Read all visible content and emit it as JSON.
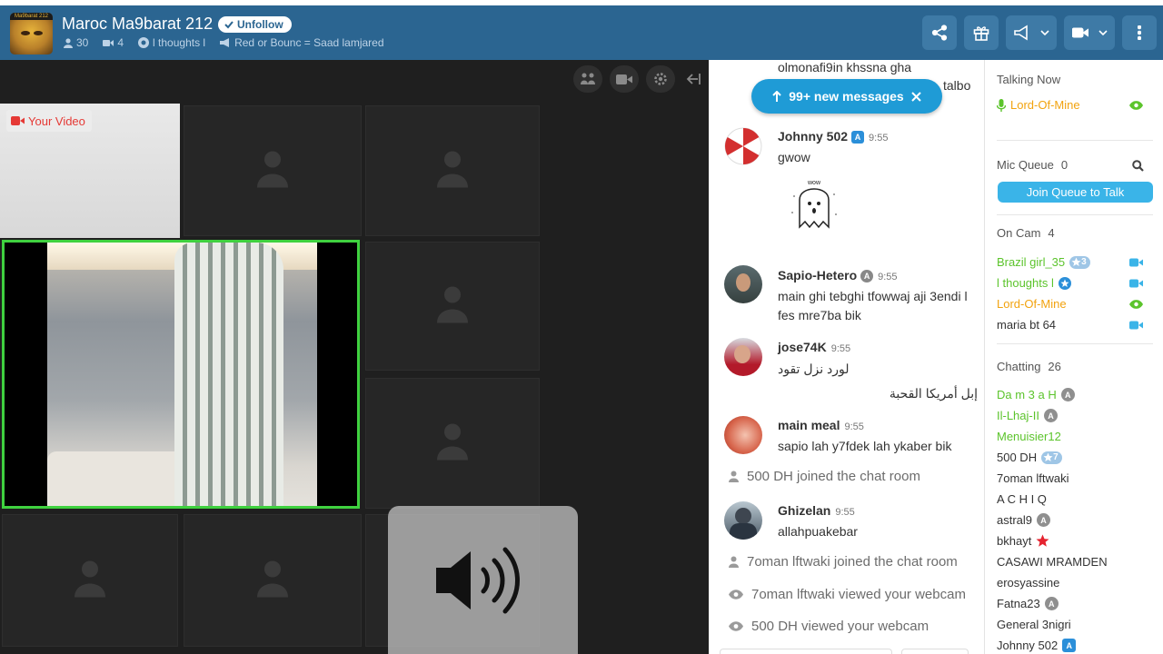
{
  "header": {
    "room_title": "Maroc Ma9barat 212",
    "room_avatar_caption": "Ma9barat 212",
    "unfollow_label": "Unfollow",
    "users_count": "30",
    "cams_count": "4",
    "owner": "l thoughts l",
    "topic": "Red or Bounc = Saad lamjared",
    "buttons": [
      "share-icon",
      "gift-icon",
      "broadcast-icon",
      "camera-icon",
      "more-icon"
    ]
  },
  "video": {
    "your_video_label": "Your Video",
    "tools": [
      "hide-users-icon",
      "camera-toggle-icon",
      "settings-icon",
      "collapse-icon"
    ],
    "volume_overlay_icon": "speaker-volume-icon"
  },
  "chat": {
    "top_partial_1": "olmonafi9in khssna gha",
    "top_partial_2": "talbo",
    "new_messages_label": "99+ new messages",
    "messages": [
      {
        "name": "Johnny 502",
        "badge": "A",
        "time": "9:55",
        "text": "gwow"
      },
      {
        "name": "Sapio-Hetero",
        "badge": "A",
        "time": "9:55",
        "text": "main ghi tebghi tfowwaj aji 3endi l fes mre7ba bik"
      },
      {
        "name": "jose74K",
        "badge": "",
        "time": "9:55",
        "text1": "لورد نزل تقود",
        "text2": "إبل أمريكا القحبة"
      },
      {
        "name": "main meal",
        "badge": "",
        "time": "9:55",
        "text": "sapio lah y7fdek lah ykaber bik"
      },
      {
        "name": "Ghizelan",
        "badge": "",
        "time": "9:55",
        "text": "allahpuakebar"
      }
    ],
    "system": [
      "500 DH joined the chat room",
      "7oman lftwaki joined the chat room",
      "7oman lftwaki viewed your webcam",
      "500 DH viewed your webcam"
    ],
    "sticker_text": "wow"
  },
  "sidebar": {
    "talking_now_label": "Talking Now",
    "talking_user": "Lord-Of-Mine",
    "mic_queue_label": "Mic Queue",
    "mic_queue_count": "0",
    "join_queue_label": "Join Queue to Talk",
    "on_cam_label": "On Cam",
    "on_cam_count": "4",
    "on_cam_users": [
      {
        "name": "Brazil girl_35",
        "level": "3"
      },
      {
        "name": "l thoughts l"
      },
      {
        "name": "Lord-Of-Mine"
      },
      {
        "name": "maria bt 64"
      }
    ],
    "chatting_label": "Chatting",
    "chatting_count": "26",
    "chatting_users": [
      {
        "name": "Da m 3 a H",
        "badge": "A"
      },
      {
        "name": "Il-Lhaj-II",
        "badge": "A"
      },
      {
        "name": "Menuisier12"
      },
      {
        "name": "500 DH",
        "level": "7"
      },
      {
        "name": "7oman lftwaki"
      },
      {
        "name": "A C H I Q"
      },
      {
        "name": "astral9",
        "badge": "A"
      },
      {
        "name": "bkhayt"
      },
      {
        "name": "CASAWI MRAMDEN"
      },
      {
        "name": "erosyassine"
      },
      {
        "name": "Fatna23",
        "badge": "A"
      },
      {
        "name": "General 3nigri"
      },
      {
        "name": "Johnny 502",
        "badge": "A"
      }
    ],
    "colors": {
      "green": "#5cc42c",
      "orange": "#f2a30f",
      "blue": "#2b8fd9"
    }
  }
}
